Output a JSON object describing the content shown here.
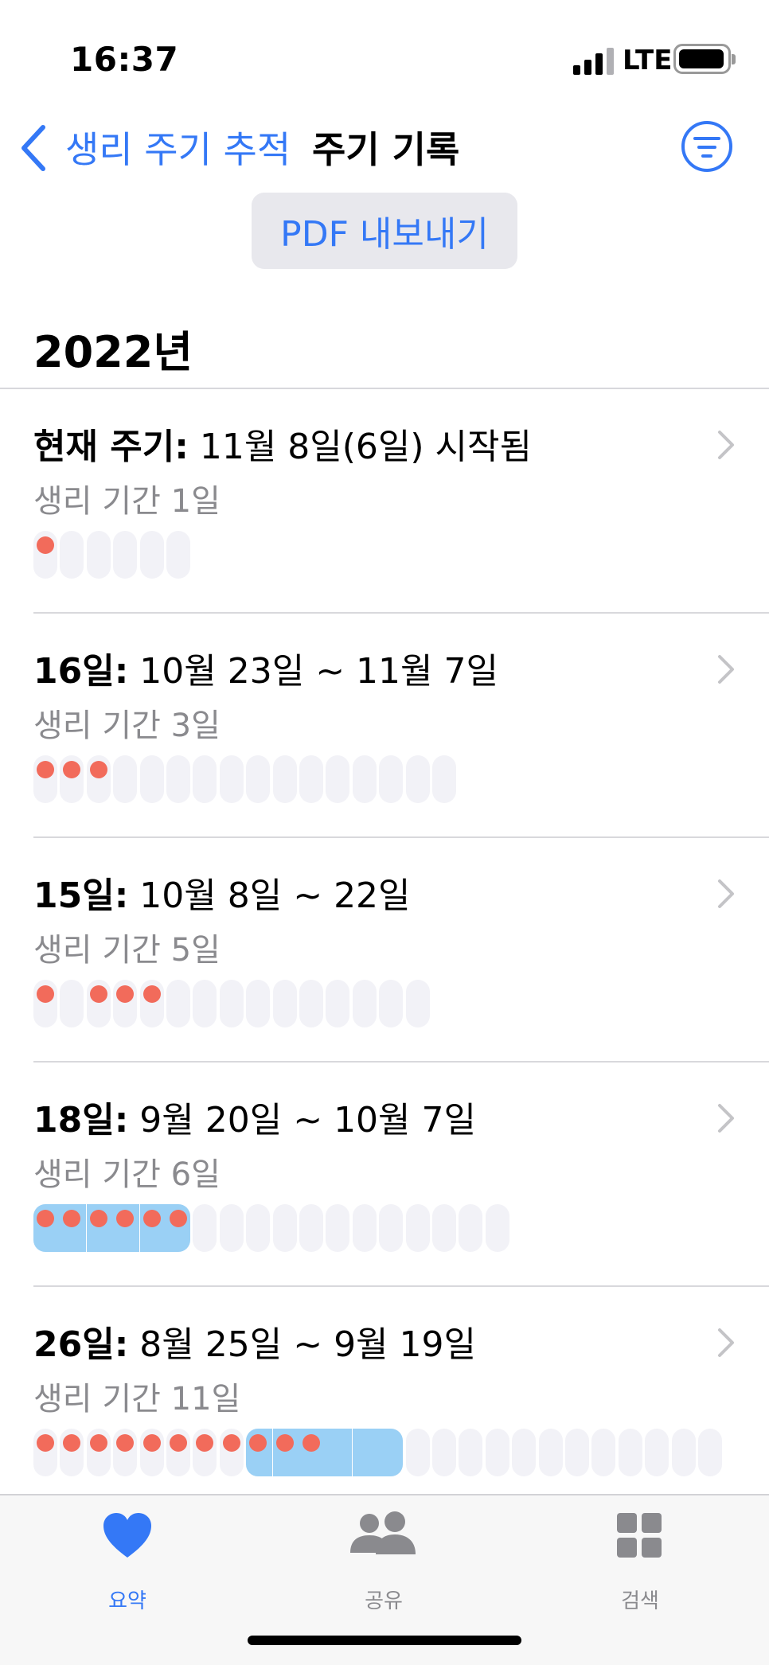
{
  "status_bar": {
    "time": "16:37",
    "network": "LTE"
  },
  "nav": {
    "back_label": "생리 주기 추적",
    "title": "주기 기록",
    "filter_icon": "filter-icon"
  },
  "export_button": "PDF 내보내기",
  "year_header": "2022년",
  "cycles": [
    {
      "title_bold": "현재 주기:",
      "title_rest": " 11월 8일(6일) 시작됨",
      "subtitle": "생리 기간 1일",
      "total_days": 6,
      "period_days": [
        1
      ],
      "fertile_days": []
    },
    {
      "title_bold": "16일:",
      "title_rest": " 10월 23일 ~ 11월 7일",
      "subtitle": "생리 기간 3일",
      "total_days": 16,
      "period_days": [
        1,
        2,
        3
      ],
      "fertile_days": []
    },
    {
      "title_bold": "15일:",
      "title_rest": " 10월 8일 ~ 22일",
      "subtitle": "생리 기간 5일",
      "total_days": 15,
      "period_days": [
        1,
        3,
        4,
        5
      ],
      "fertile_days": []
    },
    {
      "title_bold": "18일:",
      "title_rest": " 9월 20일 ~ 10월 7일",
      "subtitle": "생리 기간 6일",
      "total_days": 18,
      "period_days": [
        1,
        2,
        3,
        4,
        5,
        6
      ],
      "fertile_days": [
        1,
        2,
        3,
        4,
        5,
        6
      ]
    },
    {
      "title_bold": "26일:",
      "title_rest": " 8월 25일 ~ 9월 19일",
      "subtitle": "생리 기간 11일",
      "total_days": 26,
      "period_days": [
        1,
        2,
        3,
        4,
        5,
        6,
        7,
        8,
        9,
        10,
        11
      ],
      "fertile_days": [
        9,
        10,
        11,
        12,
        13,
        14
      ]
    }
  ],
  "tabs": [
    {
      "label": "요약",
      "icon": "heart-icon",
      "active": true
    },
    {
      "label": "공유",
      "icon": "people-icon",
      "active": false
    },
    {
      "label": "검색",
      "icon": "grid-icon",
      "active": false
    }
  ],
  "colors": {
    "accent": "#3478f6",
    "period": "#f26b5b",
    "fertile": "#9ad0f5",
    "inactive": "#8a8a8e"
  }
}
